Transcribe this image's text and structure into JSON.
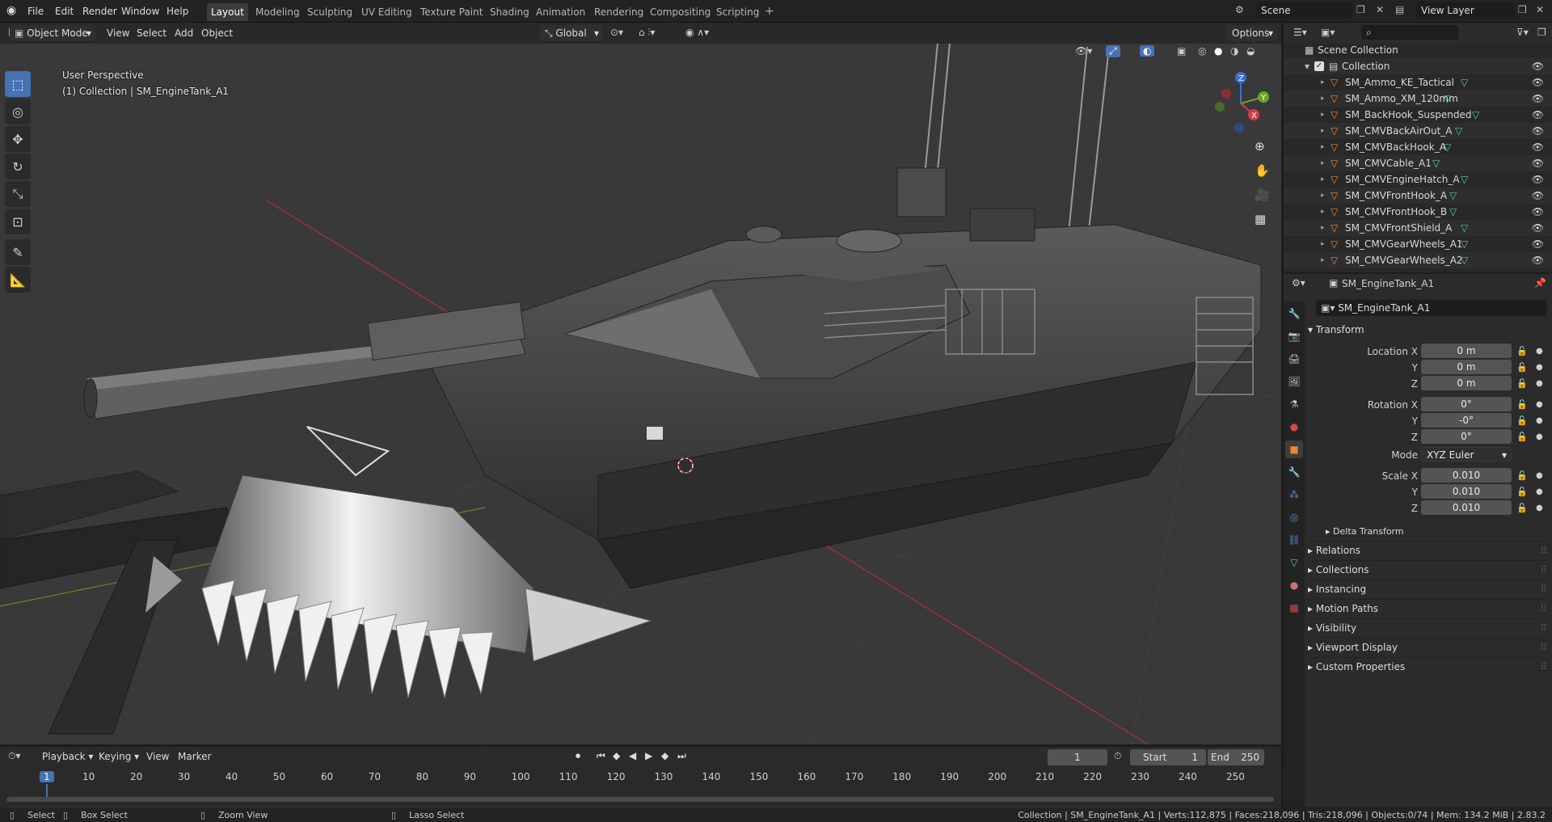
{
  "topbar": {
    "menus": [
      "File",
      "Edit",
      "Render",
      "Window",
      "Help"
    ],
    "workspaces": [
      "Layout",
      "Modeling",
      "Sculpting",
      "UV Editing",
      "Texture Paint",
      "Shading",
      "Animation",
      "Rendering",
      "Compositing",
      "Scripting"
    ],
    "active_workspace": "Layout",
    "scene": "Scene",
    "view_layer": "View Layer"
  },
  "viewport": {
    "mode": "Object Mode",
    "menus": [
      "View",
      "Select",
      "Add",
      "Object"
    ],
    "transform_orientation": "Global",
    "options": "Options",
    "perspective": "User Perspective",
    "collection_info": "(1) Collection | SM_EngineTank_A1",
    "gizmo": {
      "z": "Z",
      "y": "Y",
      "x": "X"
    }
  },
  "outliner": {
    "root": "Scene Collection",
    "collection": "Collection",
    "items": [
      "SM_Ammo_KE_Tactical",
      "SM_Ammo_XM_120mm",
      "SM_BackHook_Suspended",
      "SM_CMVBackAirOut_A",
      "SM_CMVBackHook_A",
      "SM_CMVCable_A1",
      "SM_CMVEngineHatch_A",
      "SM_CMVFrontHook_A",
      "SM_CMVFrontHook_B",
      "SM_CMVFrontShield_A",
      "SM_CMVGearWheels_A1",
      "SM_CMVGearWheels_A2"
    ]
  },
  "properties": {
    "header_object": "SM_EngineTank_A1",
    "object_name": "SM_EngineTank_A1",
    "transform_label": "Transform",
    "location": {
      "label": "Location X",
      "x": "0 m",
      "y": "0 m",
      "z": "0 m"
    },
    "rotation": {
      "label": "Rotation X",
      "x": "0°",
      "y": "-0°",
      "z": "0°"
    },
    "mode_label": "Mode",
    "mode_value": "XYZ Euler",
    "scale": {
      "label": "Scale X",
      "x": "0.010",
      "y": "0.010",
      "z": "0.010"
    },
    "axis_y": "Y",
    "axis_z": "Z",
    "delta": "Delta Transform",
    "panels": [
      "Relations",
      "Collections",
      "Instancing",
      "Motion Paths",
      "Visibility",
      "Viewport Display",
      "Custom Properties"
    ]
  },
  "timeline": {
    "menus": [
      "Playback",
      "Keying",
      "View",
      "Marker"
    ],
    "current_frame": "1",
    "start_label": "Start",
    "start": "1",
    "end_label": "End",
    "end": "250",
    "ticks": [
      "1",
      "10",
      "20",
      "30",
      "40",
      "50",
      "60",
      "70",
      "80",
      "90",
      "100",
      "110",
      "120",
      "130",
      "140",
      "150",
      "160",
      "170",
      "180",
      "190",
      "200",
      "210",
      "220",
      "230",
      "240",
      "250"
    ]
  },
  "statusbar": {
    "select": "Select",
    "box_select": "Box Select",
    "zoom_view": "Zoom View",
    "lasso_select": "Lasso Select",
    "info": "Collection | SM_EngineTank_A1 | Verts:112,875 | Faces:218,096 | Tris:218,096 | Objects:0/74 | Mem: 134.2 MiB | 2.83.2"
  },
  "colors": {
    "accent": "#4772b3",
    "object_orange": "#e8883a",
    "mesh_green": "#5fc9a0"
  }
}
